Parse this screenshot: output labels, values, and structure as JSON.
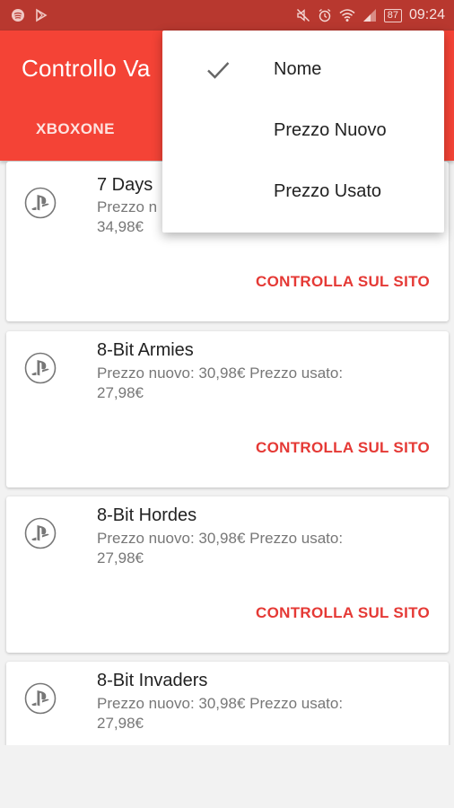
{
  "status_bar": {
    "battery": "87",
    "time": "09:24"
  },
  "app_bar": {
    "title": "Controllo Va",
    "tabs": [
      {
        "label": "XBOXONE"
      }
    ]
  },
  "sort_menu": {
    "items": [
      {
        "label": "Nome",
        "checked": true
      },
      {
        "label": "Prezzo Nuovo",
        "checked": false
      },
      {
        "label": "Prezzo Usato",
        "checked": false
      }
    ]
  },
  "games": [
    {
      "name": "7 Days",
      "prices_line1": "Prezzo n",
      "prices_line2": "34,98€",
      "action": "CONTROLLA SUL SITO"
    },
    {
      "name": "8-Bit Armies",
      "prices_line1": "Prezzo nuovo:  30,98€ Prezzo usato:",
      "prices_line2": "27,98€",
      "action": "CONTROLLA SUL SITO"
    },
    {
      "name": "8-Bit Hordes",
      "prices_line1": "Prezzo nuovo:  30,98€ Prezzo usato:",
      "prices_line2": "27,98€",
      "action": "CONTROLLA SUL SITO"
    },
    {
      "name": "8-Bit Invaders",
      "prices_line1": "Prezzo nuovo:  30,98€ Prezzo usato:",
      "prices_line2": "27,98€",
      "action": ""
    }
  ],
  "colors": {
    "status_bar": "#b8382f",
    "app_bar": "#f44336",
    "action_text": "#e53935"
  },
  "icons": {
    "card_icon": "playstation-icon",
    "menu_check": "check-icon"
  }
}
